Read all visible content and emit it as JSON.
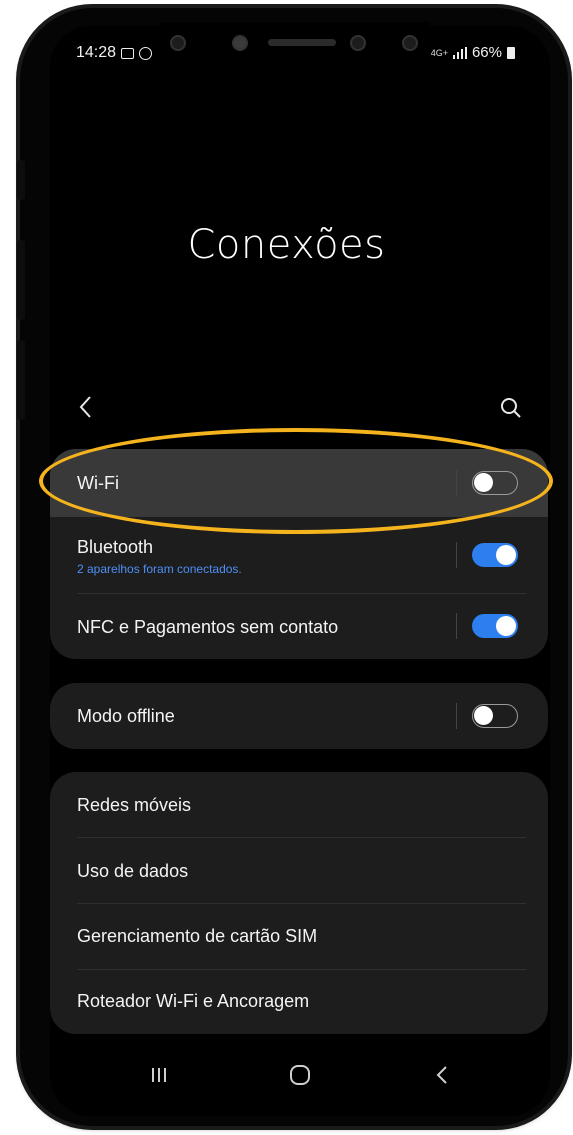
{
  "status_bar": {
    "time": "14:28",
    "network": "4G+",
    "battery": "66%",
    "left_icons": [
      "gallery-icon",
      "whatsapp-icon"
    ]
  },
  "header": {
    "title": "Conexões",
    "back_icon": "chevron-left-icon",
    "search_icon": "search-icon"
  },
  "groups": [
    {
      "items": [
        {
          "label": "Wi-Fi",
          "toggle": "off",
          "highlighted": true
        },
        {
          "label": "Bluetooth",
          "subtitle": "2 aparelhos foram conectados.",
          "toggle": "on"
        },
        {
          "label": "NFC e Pagamentos sem contato",
          "toggle": "on"
        }
      ]
    },
    {
      "items": [
        {
          "label": "Modo offline",
          "toggle": "off"
        }
      ]
    },
    {
      "items": [
        {
          "label": "Redes móveis"
        },
        {
          "label": "Uso de dados"
        },
        {
          "label": "Gerenciamento de cartão SIM"
        },
        {
          "label": "Roteador Wi-Fi e Ancoragem"
        }
      ]
    }
  ],
  "nav_bar": {
    "icons": [
      "recents-icon",
      "home-icon",
      "back-icon"
    ]
  },
  "colors": {
    "accent": "#2d7ff0",
    "subtitle": "#4d8ff5",
    "highlight_ring": "#f5b41e",
    "card": "#1d1d1d",
    "highlighted_row": "#393939"
  }
}
